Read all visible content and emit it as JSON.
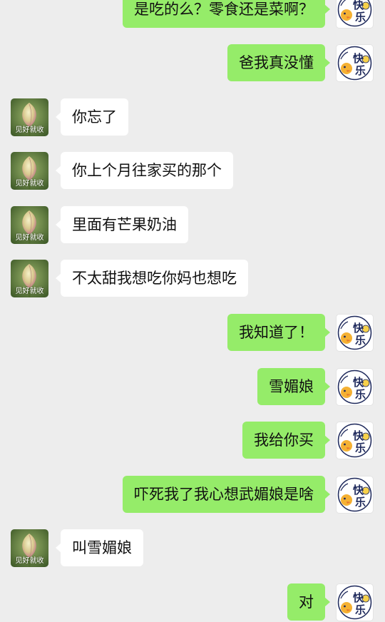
{
  "app": {
    "background_color": "#ededed"
  },
  "colors": {
    "outgoing_bubble": "#95ec69",
    "incoming_bubble": "#ffffff"
  },
  "avatars": {
    "me": {
      "icon": "kuaile-duck-sticker-icon",
      "text": "快乐"
    },
    "them": {
      "icon": "lotus-bud-icon",
      "caption": "见好就收"
    }
  },
  "messages": [
    {
      "sender": "me",
      "text": "是吃的么？零食还是菜啊？"
    },
    {
      "sender": "me",
      "text": "爸我真没懂"
    },
    {
      "sender": "them",
      "text": "你忘了"
    },
    {
      "sender": "them",
      "text": "你上个月往家买的那个"
    },
    {
      "sender": "them",
      "text": "里面有芒果奶油"
    },
    {
      "sender": "them",
      "text": "不太甜我想吃你妈也想吃"
    },
    {
      "sender": "me",
      "text": "我知道了！"
    },
    {
      "sender": "me",
      "text": "雪媚娘"
    },
    {
      "sender": "me",
      "text": "我给你买"
    },
    {
      "sender": "me",
      "text": "吓死我了我心想武媚娘是啥"
    },
    {
      "sender": "them",
      "text": "叫雪媚娘"
    },
    {
      "sender": "me",
      "text": "对"
    }
  ]
}
